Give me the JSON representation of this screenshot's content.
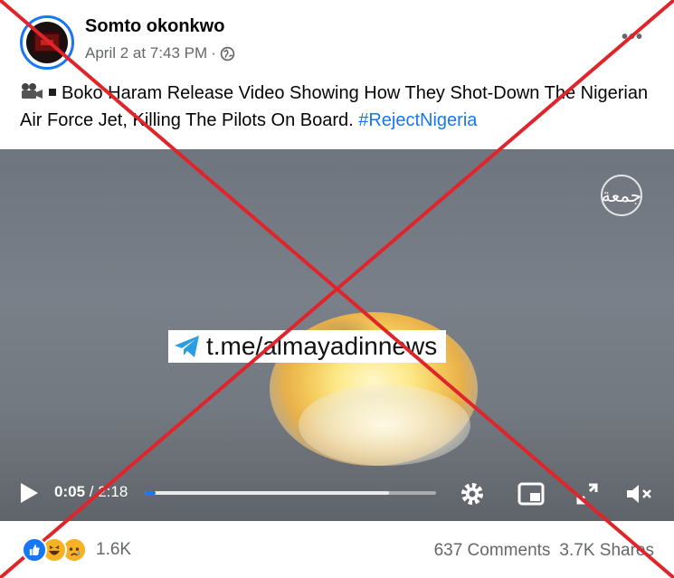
{
  "post": {
    "author": "Somto okonkwo",
    "timestamp": "April 2 at 7:43 PM",
    "separator": "·",
    "privacy_icon": "globe-icon",
    "more_label": "•••",
    "text_main": "Boko Haram Release Video Showing How They Shot-Down The Nigerian Air Force Jet, Killing The Pilots On Board.",
    "hashtag": "#RejectNigeria"
  },
  "video": {
    "overlay_text": "t.me/almayadinnews",
    "watermark": "جمعة",
    "current_time": "0:05",
    "time_separator": " / ",
    "total_time": "2:18",
    "progress_fraction": 0.037,
    "buffered_fraction": 0.84
  },
  "engagement": {
    "reaction_count": "1.6K",
    "comments": "637 Comments",
    "shares": "3.7K Shares",
    "reaction_icons": [
      "like-icon",
      "haha-icon",
      "sad-icon"
    ]
  },
  "colors": {
    "accent": "#1877f2",
    "cross": "#e0242b",
    "secondary_text": "#65676b"
  }
}
